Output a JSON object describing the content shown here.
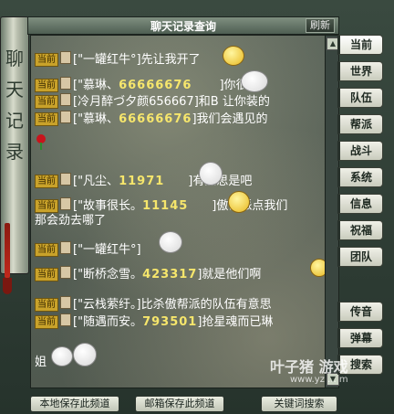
{
  "window": {
    "title": "聊天记录查询",
    "refresh_label": "刷新",
    "left_scroll_text": "聊天记录"
  },
  "chat": {
    "current_tag": "当前",
    "lines": [
      {
        "text": "[\"一罐红牛°]先让我开了"
      },
      {
        "name": "[\"慕琳、",
        "num": "66666676",
        "msg": "]你很牛"
      },
      {
        "text": "[冷月醉づ夕颜656667]和B 让你装的"
      },
      {
        "name": "[\"慕琳、",
        "num": "66666676",
        "msg": "]我们会遇见的"
      },
      {
        "name": "[\"凡尘、",
        "num": "11971",
        "msg": "]有意思是吧"
      },
      {
        "name": "[\"故事很长。",
        "num": "11145",
        "msg": "]傲帮派点我们"
      },
      {
        "text": "那会劲去哪了"
      },
      {
        "text": "[\"一罐红牛°]"
      },
      {
        "name": "[\"断桥念雪。",
        "num": "423317",
        "msg": "]就是他们啊"
      },
      {
        "text": "[\"云栈萦纡。]比杀傲帮派的队伍有意思"
      },
      {
        "name": "[\"随遇而安。",
        "num": "793501",
        "msg": "]抢星魂而已琳"
      },
      {
        "text": "姐"
      }
    ]
  },
  "tabs": [
    "当前",
    "世界",
    "队伍",
    "帮派",
    "战斗",
    "系统",
    "信息",
    "祝福",
    "团队",
    "传音",
    "弹幕",
    "搜索"
  ],
  "buttons": {
    "save_local": "本地保存此频道",
    "save_mail": "邮箱保存此频道",
    "keyword_search": "关键词搜索"
  },
  "watermark": {
    "line1": "叶子猪 游戏",
    "line2": "www.yz ... m"
  },
  "colors": {
    "tag_bg": "#c9a22a",
    "highlight_num": "#f6e66c",
    "panel_bg": "#56604f"
  }
}
